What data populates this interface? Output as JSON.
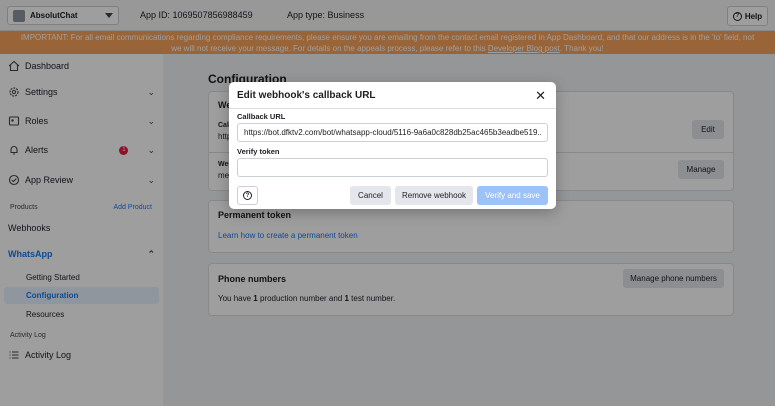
{
  "topbar": {
    "app_name": "AbsolutChat",
    "app_id_label": "App ID:",
    "app_id": "1069507856988459",
    "app_type_label": "App type:",
    "app_type": "Business",
    "help_label": "Help"
  },
  "banner": {
    "line1": "IMPORTANT: For all email communications regarding compliance requirements, please ensure you are emailing from the contact email registered in App Dashboard, and that our address is in the 'to' field, not",
    "line2_before": "we will not receive your message. For details on the appeals process, please refer to this ",
    "line2_link": "Developer Blog post",
    "line2_after": ". Thank you!"
  },
  "sidebar": {
    "dashboard": "Dashboard",
    "settings": "Settings",
    "roles": "Roles",
    "alerts": "Alerts",
    "alerts_count": "1",
    "app_review": "App Review",
    "products_label": "Products",
    "add_product": "Add Product",
    "webhooks": "Webhooks",
    "whatsapp": "WhatsApp",
    "getting_started": "Getting Started",
    "configuration": "Configuration",
    "resources": "Resources",
    "activity_log_section": "Activity Log",
    "activity_log": "Activity Log"
  },
  "main": {
    "title": "Configuration",
    "webhook_card": {
      "title_partial": "We",
      "callback_partial": "Cal",
      "callback_value_partial": "http",
      "verify_partial": "Web",
      "verify_value_partial": "me",
      "edit_label": "Edit",
      "manage_label": "Manage"
    },
    "permanent_token": {
      "title": "Permanent token",
      "link": "Learn how to create a permanent token"
    },
    "phone_numbers": {
      "title": "Phone numbers",
      "manage_label": "Manage phone numbers",
      "text_before": "You have ",
      "production_count": "1",
      "text_middle": " production number and ",
      "test_count": "1",
      "text_after": " test number."
    }
  },
  "modal": {
    "title": "Edit webhook's callback URL",
    "callback_label": "Callback URL",
    "callback_value": "https://bot.dfktv2.com/bot/whatsapp-cloud/5116-9a6a0c828db25ac465b3eadbe519...",
    "verify_label": "Verify token",
    "verify_value": "",
    "cancel_label": "Cancel",
    "remove_label": "Remove webhook",
    "save_label": "Verify and save"
  }
}
